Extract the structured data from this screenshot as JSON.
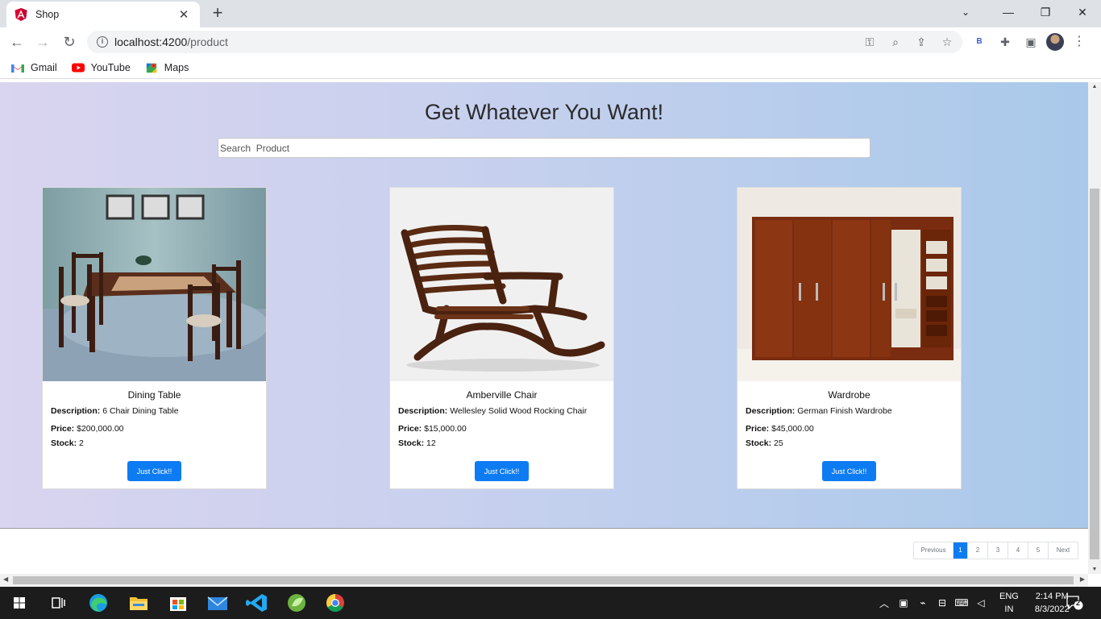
{
  "browser": {
    "tab_title": "Shop",
    "url_host": "localhost:4200",
    "url_path": "/product",
    "extension_label": "B",
    "bookmarks": [
      {
        "label": "Gmail",
        "icon": "gmail-icon"
      },
      {
        "label": "YouTube",
        "icon": "youtube-icon"
      },
      {
        "label": "Maps",
        "icon": "maps-icon"
      }
    ]
  },
  "page": {
    "heading": "Get Whatever You Want!",
    "search_placeholder": "Search  Product",
    "labels": {
      "description": "Description:",
      "price": "Price:",
      "stock": "Stock:"
    },
    "button_label": "Just Click!!",
    "products": [
      {
        "name": "Dining Table",
        "description": "6 Chair Dining Table",
        "price": "$200,000.00",
        "stock": "2"
      },
      {
        "name": "Amberville Chair",
        "description": "Wellesley Solid Wood Rocking Chair",
        "price": "$15,000.00",
        "stock": "12"
      },
      {
        "name": "Wardrobe",
        "description": "German Finish Wardrobe",
        "price": "$45,000.00",
        "stock": "25"
      }
    ],
    "pagination": {
      "previous": "Previous",
      "pages": [
        "1",
        "2",
        "3",
        "4",
        "5"
      ],
      "active_page": "1",
      "next": "Next"
    }
  },
  "taskbar": {
    "language": "ENG",
    "region": "IN",
    "time": "2:14 PM",
    "date": "8/3/2022",
    "notification_count": "2"
  },
  "colors": {
    "primary_button": "#0d7cf2",
    "hero_gradient_start": "#d9d4ef",
    "hero_gradient_end": "#a9c9ea"
  }
}
